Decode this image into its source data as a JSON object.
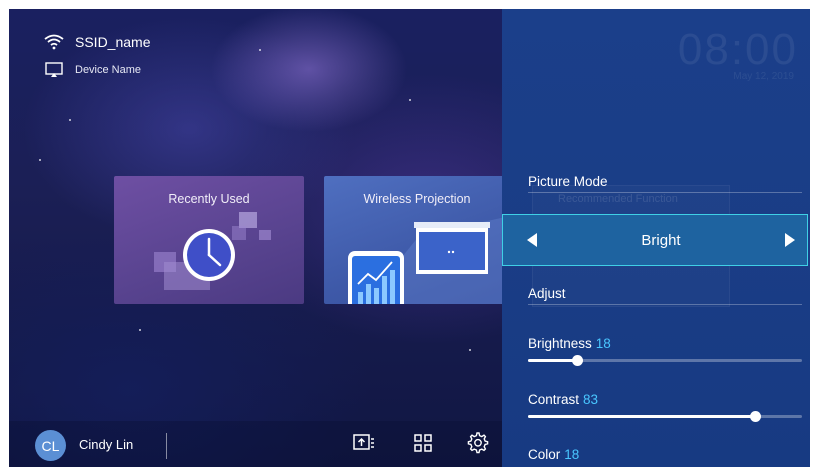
{
  "status": {
    "ssid": "SSID_name",
    "device": "Device Name"
  },
  "cards": {
    "recent": "Recently Used",
    "wireless": "Wireless Projection"
  },
  "user": {
    "initials": "CL",
    "name": "Cindy Lin"
  },
  "bottom_icons": [
    "screen-mirror-icon",
    "apps-grid-icon",
    "settings-gear-icon"
  ],
  "clock": {
    "time": "08:00",
    "date": "May 12, 2019"
  },
  "panel": {
    "picture_mode_label": "Picture Mode",
    "recommended_function": "Recommended Function",
    "picture_mode_value": "Bright",
    "adjust_label": "Adjust",
    "sliders": [
      {
        "label": "Brightness",
        "value": 18,
        "max": 100
      },
      {
        "label": "Contrast",
        "value": 83,
        "max": 100
      },
      {
        "label": "Color",
        "value": 18,
        "max": 100
      }
    ]
  },
  "colors": {
    "panel_bg": "#1b3f8a",
    "selector_bg": "#1e63a0",
    "selector_border": "#3fd0e6",
    "value_accent": "#49c6ff",
    "avatar_bg": "#5b8fd4"
  }
}
